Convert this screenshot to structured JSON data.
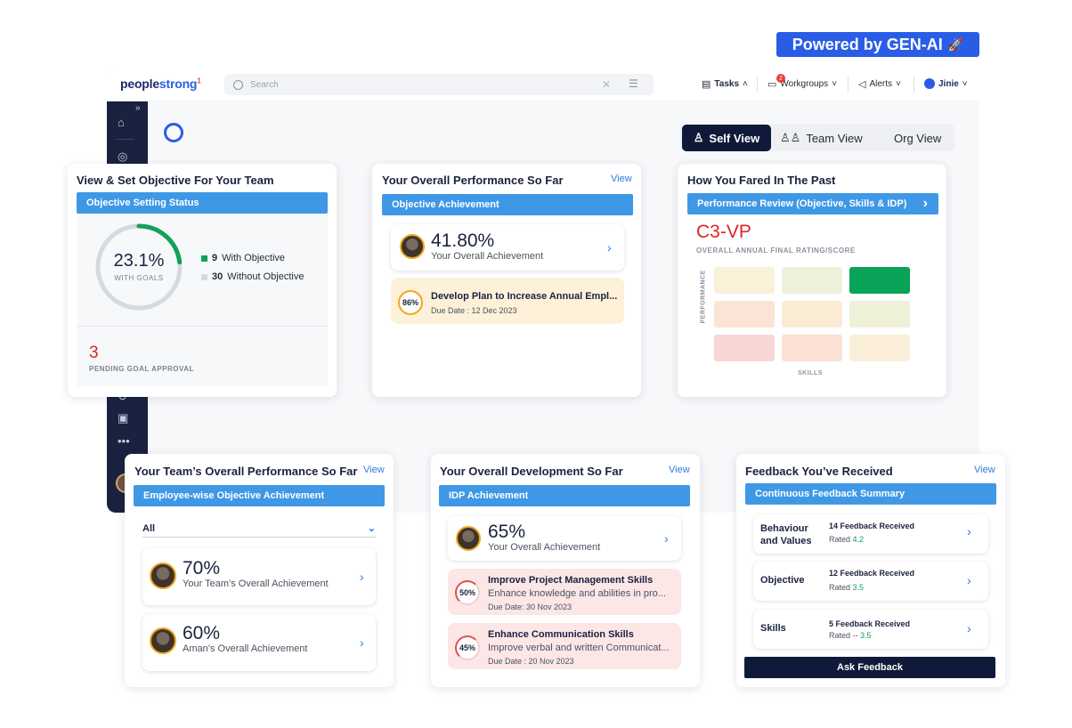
{
  "genai_badge": "Powered by GEN-AI",
  "app": {
    "logo_a": "people",
    "logo_b": "strong",
    "search_placeholder": "Search",
    "nav": {
      "tasks": "Tasks",
      "workgroups": "Workgroups",
      "workgroups_badge": "2",
      "alerts": "Alerts",
      "user": "Jinie"
    }
  },
  "view_switch": {
    "self": "Self View",
    "team": "Team View",
    "org": "Org View"
  },
  "objective_card": {
    "title": "View & Set Objective For Your Team",
    "bar": "Objective Setting Status",
    "percent": "23.1%",
    "percent_label": "WITH GOALS",
    "with_count": "9",
    "with_label": "With Objective",
    "without_count": "30",
    "without_label": "Without Objective",
    "pending_count": "3",
    "pending_label": "PENDING GOAL APPROVAL",
    "progress_fraction": 0.231,
    "colors": {
      "progress": "#12a15a",
      "track": "#d6d9df",
      "pending": "#e02424"
    }
  },
  "performance_card": {
    "title": "Your Overall Performance So Far",
    "view": "View",
    "bar": "Objective Achievement",
    "value": "41.80%",
    "value_label": "Your Overall Achievement",
    "goal_pct": "86%",
    "goal_title": "Develop Plan to Increase Annual Empl...",
    "goal_due": "Due Date : 12 Dec 2023"
  },
  "past_card": {
    "title": "How You Fared In The Past",
    "bar": "Performance Review (Objective, Skills & IDP)",
    "rating": "C3-VP",
    "rating_label": "OVERALL ANNUAL FINAL RATING/SCORE",
    "y_axis": "PERFORMANCE",
    "x_axis": "SKILLS",
    "grid_colors": [
      [
        "#fbf0d8",
        "#eef2dc",
        "#0aa35a"
      ],
      [
        "#fbe4d6",
        "#fbecd6",
        "#eef0d8"
      ],
      [
        "#f8d6d6",
        "#fbe2d4",
        "#fbeed8"
      ]
    ]
  },
  "team_card": {
    "title": "Your Team’s Overall Performance So Far",
    "view": "View",
    "bar": "Employee-wise Objective Achievement",
    "filter": "All",
    "rows": [
      {
        "value": "70%",
        "label": "Your Team’s Overall Achievement"
      },
      {
        "value": "60%",
        "label": "Aman’s Overall Achievement"
      }
    ]
  },
  "dev_card": {
    "title": "Your Overall Development So Far",
    "view": "View",
    "bar": "IDP Achievement",
    "value": "65%",
    "value_label": "Your Overall Achievement",
    "items": [
      {
        "pct": "50%",
        "title": "Improve Project Management Skills",
        "desc": "Enhance knowledge and abilities in pro...",
        "due": "Due Date: 30 Nov 2023"
      },
      {
        "pct": "45%",
        "title": "Enhance Communication Skills",
        "desc": "Improve verbal and written Communicat...",
        "due": "Due Date : 20 Nov 2023"
      }
    ]
  },
  "feedback_card": {
    "title": "Feedback You’ve Received",
    "view": "View",
    "bar": "Continuous Feedback Summary",
    "rows": [
      {
        "name_line1": "Behaviour",
        "name_line2": "and Values",
        "received": "14 Feedback Received",
        "rated_label": "Rated",
        "rating": "4.2"
      },
      {
        "name_line1": "Objective",
        "name_line2": "",
        "received": "12 Feedback Received",
        "rated_label": "Rated",
        "rating": "3.5"
      },
      {
        "name_line1": "Skills",
        "name_line2": "",
        "received": "5 Feedback Received",
        "rated_label": "Rated --",
        "rating": "3.5"
      }
    ],
    "button": "Ask Feedback"
  }
}
